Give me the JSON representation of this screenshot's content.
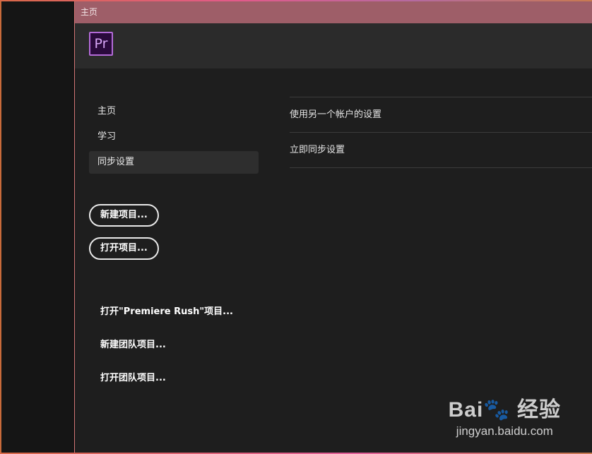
{
  "window": {
    "title": "主页"
  },
  "app": {
    "logo_text": "Pr"
  },
  "sidebar": {
    "items": [
      {
        "label": "主页"
      },
      {
        "label": "学习"
      },
      {
        "label": "同步设置",
        "active": true
      }
    ]
  },
  "actions": {
    "new_project": "新建项目...",
    "open_project": "打开项目...",
    "open_rush": "打开\"Premiere Rush\"项目...",
    "new_team": "新建团队项目...",
    "open_team": "打开团队项目..."
  },
  "sync_settings": {
    "rows": [
      {
        "label": "使用另一个帐户的设置"
      },
      {
        "label": "立即同步设置"
      }
    ]
  },
  "watermark": {
    "logo": "Bai🐾 经验",
    "url": "jingyan.baidu.com"
  },
  "colors": {
    "titlebar": "#9e5e68",
    "header": "#2b2b2b",
    "panel": "#1e1e1e",
    "logo_accent": "#b36ad8"
  }
}
